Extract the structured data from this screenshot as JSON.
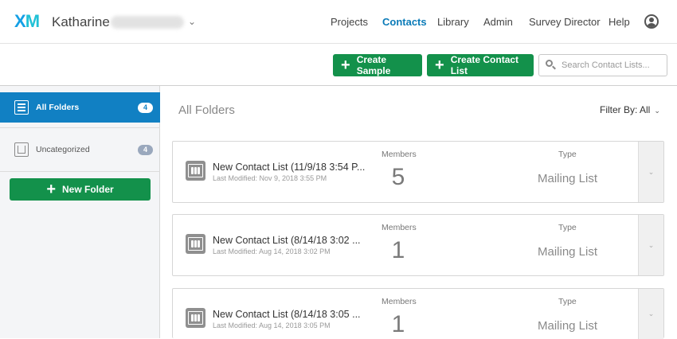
{
  "brand": {
    "logo_x": "X",
    "logo_m": "M"
  },
  "user": {
    "first_name": "Katharine"
  },
  "nav": {
    "items": [
      "Projects",
      "Contacts",
      "Library",
      "Admin",
      "Survey Director",
      "Help"
    ],
    "active": "Contacts"
  },
  "toolbar": {
    "create_sample": "Create Sample",
    "create_contact_list": "Create Contact List",
    "search_placeholder": "Search Contact Lists..."
  },
  "sidebar": {
    "folders": [
      {
        "label": "All Folders",
        "count": "4",
        "active": true
      },
      {
        "label": "Uncategorized",
        "count": "4",
        "active": false
      }
    ],
    "new_folder": "New Folder"
  },
  "main": {
    "title": "All Folders",
    "filter_label": "Filter By: All",
    "members_header": "Members",
    "type_header": "Type",
    "lists": [
      {
        "name": "New Contact List (11/9/18 3:54 P...",
        "modified": "Last Modified: Nov 9, 2018 3:55 PM",
        "members": "5",
        "type": "Mailing List"
      },
      {
        "name": "New Contact List (8/14/18 3:02 ...",
        "modified": "Last Modified: Aug 14, 2018 3:02 PM",
        "members": "1",
        "type": "Mailing List"
      },
      {
        "name": "New Contact List (8/14/18 3:05 ...",
        "modified": "Last Modified: Aug 14, 2018 3:05 PM",
        "members": "1",
        "type": "Mailing List"
      }
    ]
  },
  "colors": {
    "accent": "#1180c3",
    "green": "#13914b",
    "logo": "#15a0e5"
  },
  "icons": [
    "user-icon",
    "plus-icon",
    "search-icon",
    "folder-icon",
    "contact-list-icon",
    "chevron-down-icon"
  ]
}
